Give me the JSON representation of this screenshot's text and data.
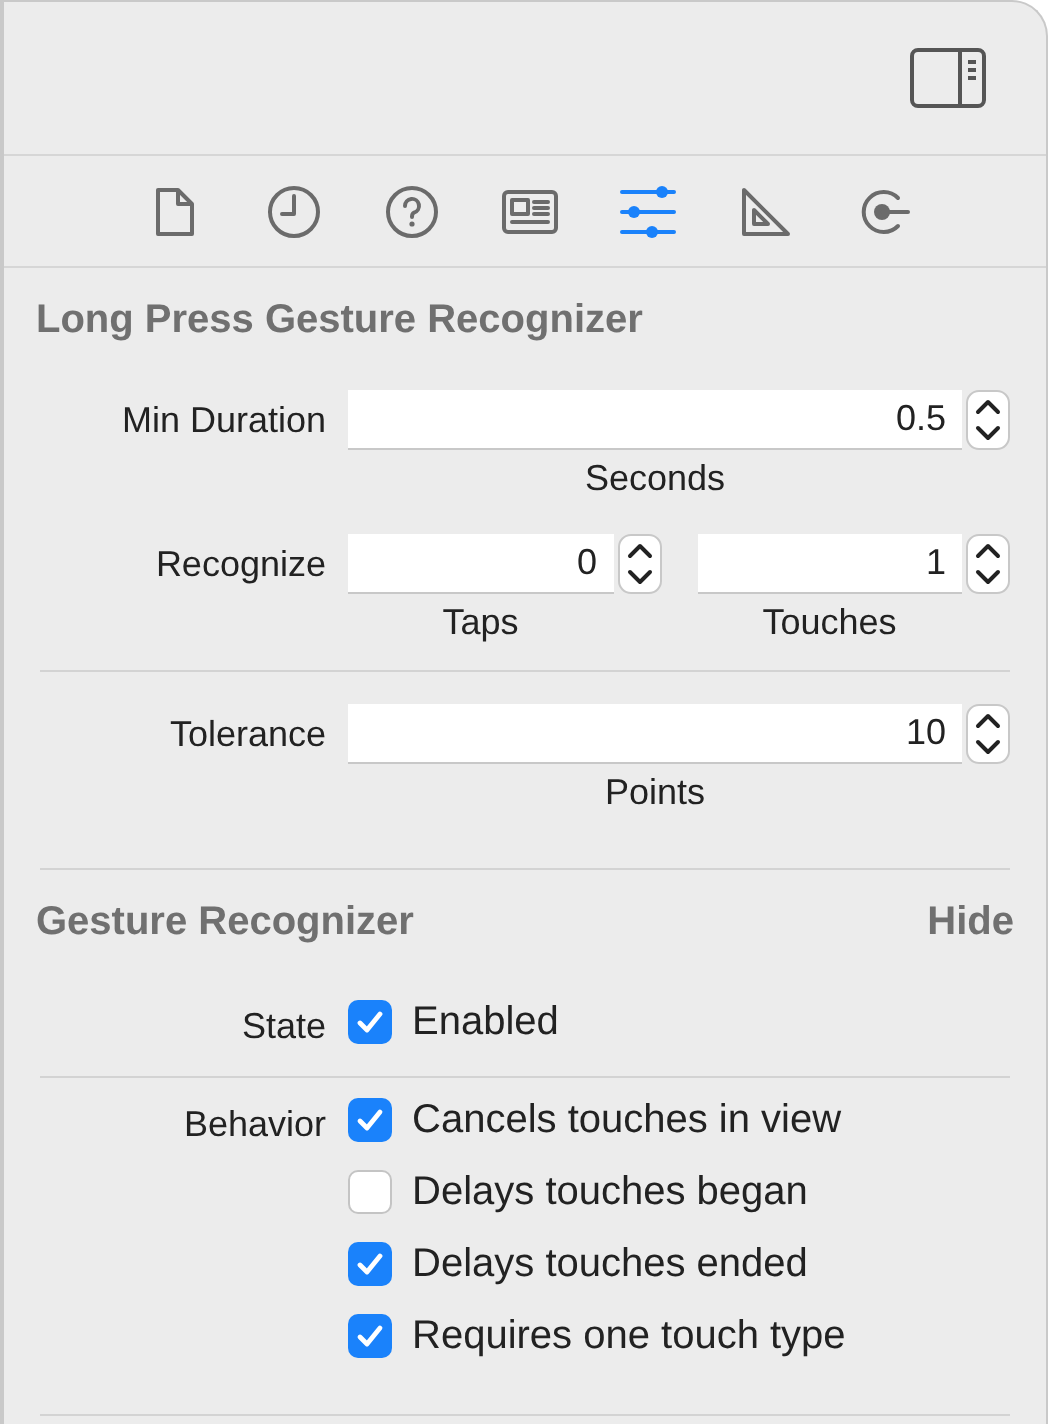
{
  "tabs": [
    {
      "kind": "file",
      "selected": false
    },
    {
      "kind": "clock",
      "selected": false
    },
    {
      "kind": "help",
      "selected": false
    },
    {
      "kind": "identity",
      "selected": false
    },
    {
      "kind": "sliders",
      "selected": true
    },
    {
      "kind": "ruler",
      "selected": false
    },
    {
      "kind": "connections",
      "selected": false
    }
  ],
  "sections": [
    {
      "title": "Long Press Gesture Recognizer",
      "groups": [
        [
          {
            "kind": "steppers",
            "label": "Min Duration",
            "fields": [
              {
                "value": "0.5",
                "caption": "Seconds"
              }
            ]
          },
          {
            "kind": "steppers",
            "label": "Recognize",
            "fields": [
              {
                "value": "0",
                "caption": "Taps"
              },
              {
                "value": "1",
                "caption": "Touches"
              }
            ]
          }
        ],
        [
          {
            "kind": "steppers",
            "label": "Tolerance",
            "fields": [
              {
                "value": "10",
                "caption": "Points"
              }
            ]
          }
        ]
      ]
    },
    {
      "title": "Gesture Recognizer",
      "action": "Hide",
      "groups": [
        [
          {
            "kind": "checks",
            "label": "State",
            "options": [
              {
                "label": "Enabled",
                "checked": true
              }
            ]
          }
        ],
        [
          {
            "kind": "checks",
            "label": "Behavior",
            "options": [
              {
                "label": "Cancels touches in view",
                "checked": true
              },
              {
                "label": "Delays touches began",
                "checked": false
              },
              {
                "label": "Delays touches ended",
                "checked": true
              },
              {
                "label": "Requires one touch type",
                "checked": true
              }
            ]
          }
        ]
      ]
    }
  ]
}
